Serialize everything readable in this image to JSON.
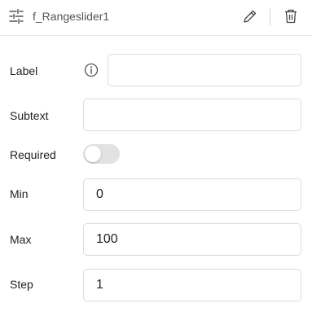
{
  "header": {
    "icon": "sliders-settings-icon",
    "title": "f_Rangeslider1",
    "edit_icon": "pencil-icon",
    "delete_icon": "trash-icon"
  },
  "form": {
    "label": {
      "label": "Label",
      "info_icon": "info-icon",
      "value": ""
    },
    "subtext": {
      "label": "Subtext",
      "value": ""
    },
    "required": {
      "label": "Required",
      "on": false
    },
    "min": {
      "label": "Min",
      "value": "0"
    },
    "max": {
      "label": "Max",
      "value": "100"
    },
    "step": {
      "label": "Step",
      "value": "1"
    }
  }
}
